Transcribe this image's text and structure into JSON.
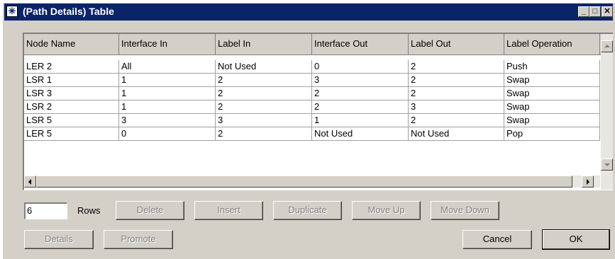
{
  "window": {
    "title": "(Path Details) Table",
    "controls": [
      "minimize",
      "maximize",
      "close"
    ]
  },
  "table": {
    "columns": [
      "Node Name",
      "Interface In",
      "Label In",
      "Interface Out",
      "Label Out",
      "Label Operation"
    ],
    "rows": [
      [
        "LER 2",
        "All",
        "Not Used",
        "0",
        "2",
        "Push"
      ],
      [
        "LSR 1",
        "1",
        "2",
        "3",
        "2",
        "Swap"
      ],
      [
        "LSR 3",
        "1",
        "2",
        "2",
        "2",
        "Swap"
      ],
      [
        "LSR 2",
        "1",
        "2",
        "2",
        "3",
        "Swap"
      ],
      [
        "LSR 5",
        "3",
        "3",
        "1",
        "2",
        "Swap"
      ],
      [
        "LER 5",
        "0",
        "2",
        "Not Used",
        "Not Used",
        "Pop"
      ]
    ]
  },
  "rows_control": {
    "value": "6",
    "label": "Rows"
  },
  "buttons": {
    "delete": "Delete",
    "insert": "Insert",
    "duplicate": "Duplicate",
    "move_up": "Move Up",
    "move_down": "Move Down",
    "details": "Details",
    "promote": "Promote",
    "cancel": "Cancel",
    "ok": "OK"
  },
  "icons": {
    "system_menu": "asterisk-icon"
  }
}
